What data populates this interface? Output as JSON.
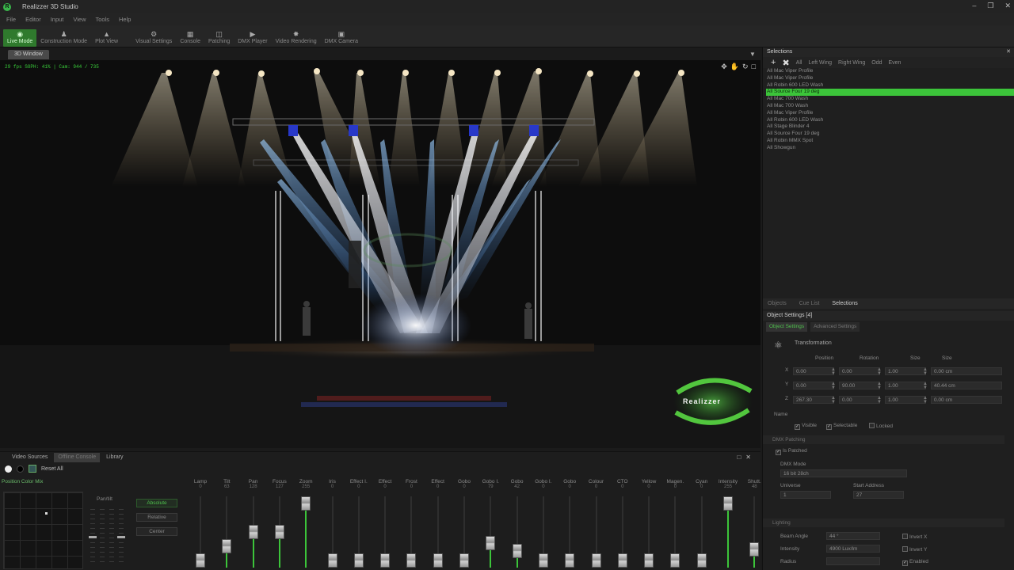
{
  "app": {
    "title": "Realizzer 3D Studio"
  },
  "menu": [
    "File",
    "Editor",
    "Input",
    "View",
    "Tools",
    "Help"
  ],
  "toolbar": [
    {
      "label": "Live Mode",
      "icon": "eye-icon",
      "active": true
    },
    {
      "label": "Construction Mode",
      "icon": "worker-icon",
      "active": false
    },
    {
      "label": "Plot View",
      "icon": "plot-icon",
      "active": false
    },
    {
      "label": "Visual Settings",
      "icon": "gear-icon",
      "active": false
    },
    {
      "label": "Console",
      "icon": "console-icon",
      "active": false
    },
    {
      "label": "Patching",
      "icon": "patching-icon",
      "active": false
    },
    {
      "label": "DMX Player",
      "icon": "play-icon",
      "active": false
    },
    {
      "label": "Video Rendering",
      "icon": "film-icon",
      "active": false
    },
    {
      "label": "DMX Camera",
      "icon": "camera-icon",
      "active": false
    }
  ],
  "viewport": {
    "tab": "3D Window",
    "fps": "29 fps SOPH: 41% | Cam: 944 / 735",
    "logo": "Realizzer"
  },
  "selections": {
    "title": "Selections",
    "filters": [
      "All",
      "Left Wing",
      "Right Wing",
      "Odd",
      "Even"
    ],
    "items": [
      "All Mac Viper Profile",
      "All Mac Viper Profile",
      "All Robin 600 LED Wash",
      "All Source Four 19 deg",
      "All Mac 700 Wash",
      "All Mac 700 Wash",
      "All Mac Viper Profile",
      "All Robin 600 LED Wash",
      "All Stage Blinder 4",
      "All Source Four 19 deg",
      "All Robin MMX Spot",
      "All Showgun"
    ],
    "selected_index": 3
  },
  "panel_tabs": [
    {
      "label": "Objects",
      "on": false
    },
    {
      "label": "Cue List",
      "on": false
    },
    {
      "label": "Selections",
      "on": true
    }
  ],
  "object_settings": {
    "title": "Object Settings [4]",
    "tabs": [
      "Object Settings",
      "Advanced Settings"
    ],
    "transformation": "Transformation",
    "headers": [
      "Position",
      "Rotation",
      "Size",
      "Size"
    ],
    "rows": [
      {
        "axis": "X",
        "pos": "0.00",
        "rot": "0.00",
        "scale": "1.00",
        "size": "0.00 cm"
      },
      {
        "axis": "Y",
        "pos": "0.00",
        "rot": "90.00",
        "scale": "1.00",
        "size": "40.44 cm"
      },
      {
        "axis": "Z",
        "pos": "267.30",
        "rot": "0.00",
        "scale": "1.00",
        "size": "0.00 cm"
      }
    ],
    "name_label": "Name",
    "checks": [
      {
        "label": "Visible",
        "checked": true
      },
      {
        "label": "Selectable",
        "checked": true
      },
      {
        "label": "Locked",
        "checked": false
      }
    ],
    "dmx_group": "DMX Patching",
    "is_patched": "Is Patched",
    "dmx_mode_label": "DMX Mode",
    "dmx_mode": "16 bit 28ch",
    "universe_label": "Universe",
    "universe": "1",
    "start_label": "Start Address",
    "start": "27",
    "lighting_group": "Lighting",
    "beam_label": "Beam Angle",
    "beam": "44 °",
    "intensity_label": "Intensity",
    "intensity": "4900 Lux/lm",
    "radius_label": "Radius",
    "invert_x": "Invert X",
    "invert_y": "Invert Y",
    "enabled": "Enabled"
  },
  "bottom": {
    "tabs": [
      "Video Sources",
      "Offline Console",
      "Library"
    ],
    "reset_label": "Reset All",
    "color_tabs": "Position  Color Mix",
    "pantilt_label": "Pan/tilt",
    "modes": [
      "Absolute",
      "Relative",
      "Center"
    ],
    "faders": [
      {
        "name": "Lamp",
        "value": "0",
        "level": 0.0
      },
      {
        "name": "Tilt",
        "value": "63",
        "level": 0.25
      },
      {
        "name": "Pan",
        "value": "128",
        "level": 0.5
      },
      {
        "name": "Focus",
        "value": "127",
        "level": 0.5
      },
      {
        "name": "Zoom",
        "value": "255",
        "level": 1.0
      },
      {
        "name": "Iris",
        "value": "0",
        "level": 0.0
      },
      {
        "name": "Effect I.",
        "value": "0",
        "level": 0.0
      },
      {
        "name": "Effect",
        "value": "0",
        "level": 0.0
      },
      {
        "name": "Frost",
        "value": "0",
        "level": 0.0
      },
      {
        "name": "Effect",
        "value": "0",
        "level": 0.0
      },
      {
        "name": "Gobo",
        "value": "0",
        "level": 0.0
      },
      {
        "name": "Gobo I.",
        "value": "79",
        "level": 0.31
      },
      {
        "name": "Gobo",
        "value": "42",
        "level": 0.16
      },
      {
        "name": "Gobo I.",
        "value": "0",
        "level": 0.0
      },
      {
        "name": "Gobo",
        "value": "0",
        "level": 0.0
      },
      {
        "name": "Colour",
        "value": "0",
        "level": 0.0
      },
      {
        "name": "CTO",
        "value": "0",
        "level": 0.0
      },
      {
        "name": "Yellow",
        "value": "0",
        "level": 0.0
      },
      {
        "name": "Magen.",
        "value": "0",
        "level": 0.0
      },
      {
        "name": "Cyan",
        "value": "0",
        "level": 0.0
      },
      {
        "name": "Intensity",
        "value": "255",
        "level": 1.0
      },
      {
        "name": "Shutt.",
        "value": "48",
        "level": 0.19
      }
    ]
  },
  "colors": {
    "accent": "#3cc43a",
    "background": "#1b1b1b",
    "panel": "#1f1f1f"
  }
}
